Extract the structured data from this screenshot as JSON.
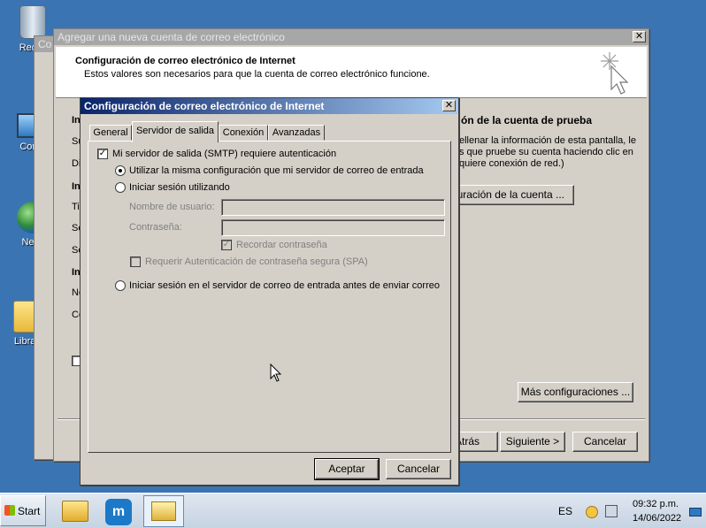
{
  "desktop": {
    "icons": [
      {
        "label": "Recycle Bin",
        "visible": "Recyc"
      },
      {
        "label": "Computer",
        "visible": "Comp"
      },
      {
        "label": "Network",
        "visible": "Netw"
      },
      {
        "label": "Libraries",
        "visible": "Libraries"
      }
    ]
  },
  "bg_window": {
    "title_fragment": "Co"
  },
  "wizard": {
    "title": "Agregar una nueva cuenta de correo electrónico",
    "header_title": "Configuración de correo electrónico de Internet",
    "header_subtitle": "Estos valores son necesarios para que la cuenta de correo electrónico funcione.",
    "left_fragments": [
      "In",
      "Su",
      "Dir",
      "In",
      "Tip",
      "Se",
      "Se",
      "In",
      "No",
      "Co"
    ],
    "test_heading": "ón de la cuenta de prueba",
    "test_text_1": "ellenar la información de esta pantalla, le",
    "test_text_2": "s que pruebe su cuenta haciendo clic en",
    "test_text_3": "quiere conexión de red.)",
    "test_button": "guración de la cuenta ...",
    "more_settings_button": "Más configuraciones ...",
    "back_button": "Atrás",
    "next_button": "Siguiente >",
    "cancel_button": "Cancelar"
  },
  "dialog": {
    "title": "Configuración de correo electrónico de Internet",
    "tabs": [
      {
        "label": "General",
        "selected": false
      },
      {
        "label": "Servidor de salida",
        "selected": true
      },
      {
        "label": "Conexión",
        "selected": false
      },
      {
        "label": "Avanzadas",
        "selected": false
      }
    ],
    "smtp_auth_label": "Mi servidor de salida (SMTP) requiere autenticación",
    "smtp_auth_checked": true,
    "opt_same_settings": "Utilizar la misma configuración que mi servidor de correo de entrada",
    "opt_login_using": "Iniciar sesión utilizando",
    "username_label": "Nombre de usuario:",
    "username_value": "",
    "password_label": "Contraseña:",
    "password_value": "",
    "remember_password_label": "Recordar contraseña",
    "spa_label": "Requerir Autenticación de contraseña segura (SPA)",
    "opt_login_incoming_first": "Iniciar sesión en el servidor de correo de entrada antes de enviar correo",
    "selected_option": "same_settings",
    "accept_button": "Aceptar",
    "cancel_button": "Cancelar"
  },
  "taskbar": {
    "start_label": "Start",
    "language": "ES",
    "time": "09:32 p.m.",
    "date": "14/06/2022",
    "apps": [
      "file-explorer",
      "maxthon-browser",
      "outlook-setup"
    ]
  }
}
